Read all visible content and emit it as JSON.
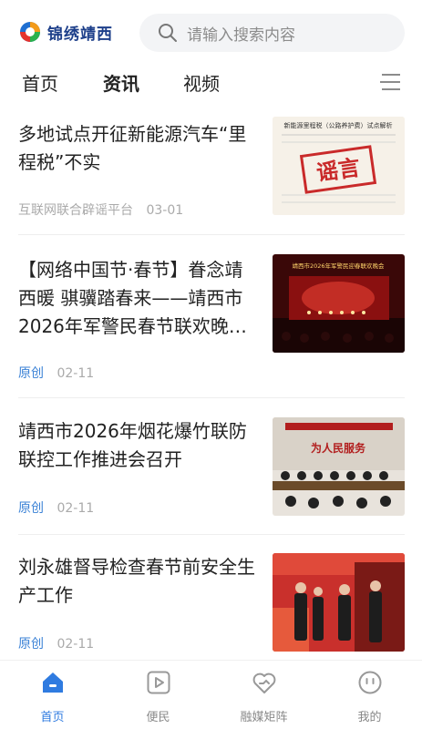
{
  "header": {
    "logo_text": "锦绣靖西",
    "search_placeholder": "请输入搜索内容"
  },
  "tabs": [
    {
      "label": "首页",
      "active": false
    },
    {
      "label": "资讯",
      "active": true
    },
    {
      "label": "视频",
      "active": false
    }
  ],
  "articles": [
    {
      "title": "多地试点开征新能源汽车“里程税”不实",
      "source": "互联网联合辟谣平台",
      "date": "03-01",
      "thumb_text": "谣言",
      "thumb_heading": "新能源里程税（公路养护费）试点解析"
    },
    {
      "title": "【网络中国节·春节】眷念靖西暖 骐骥踏春来——靖西市2026年军警民春节联欢晚…",
      "source": "原创",
      "date": "02-11",
      "thumb_heading": "靖西市2026年军警民迎春联欢晚会"
    },
    {
      "title": "靖西市2026年烟花爆竹联防联控工作推进会召开",
      "source": "原创",
      "date": "02-11",
      "thumb_heading": "为人民服务"
    },
    {
      "title": "刘永雄督导检查春节前安全生产工作",
      "source": "原创",
      "date": "02-11"
    }
  ],
  "bottom_nav": [
    {
      "label": "首页",
      "icon": "home-icon",
      "active": true
    },
    {
      "label": "便民",
      "icon": "play-icon",
      "active": false
    },
    {
      "label": "融媒矩阵",
      "icon": "heart-icon",
      "active": false
    },
    {
      "label": "我的",
      "icon": "smile-icon",
      "active": false
    }
  ],
  "colors": {
    "accent": "#2f7be0",
    "brand": "#1d3f8a",
    "meta": "#aaaaaa",
    "original_tag": "#3b82d6"
  }
}
